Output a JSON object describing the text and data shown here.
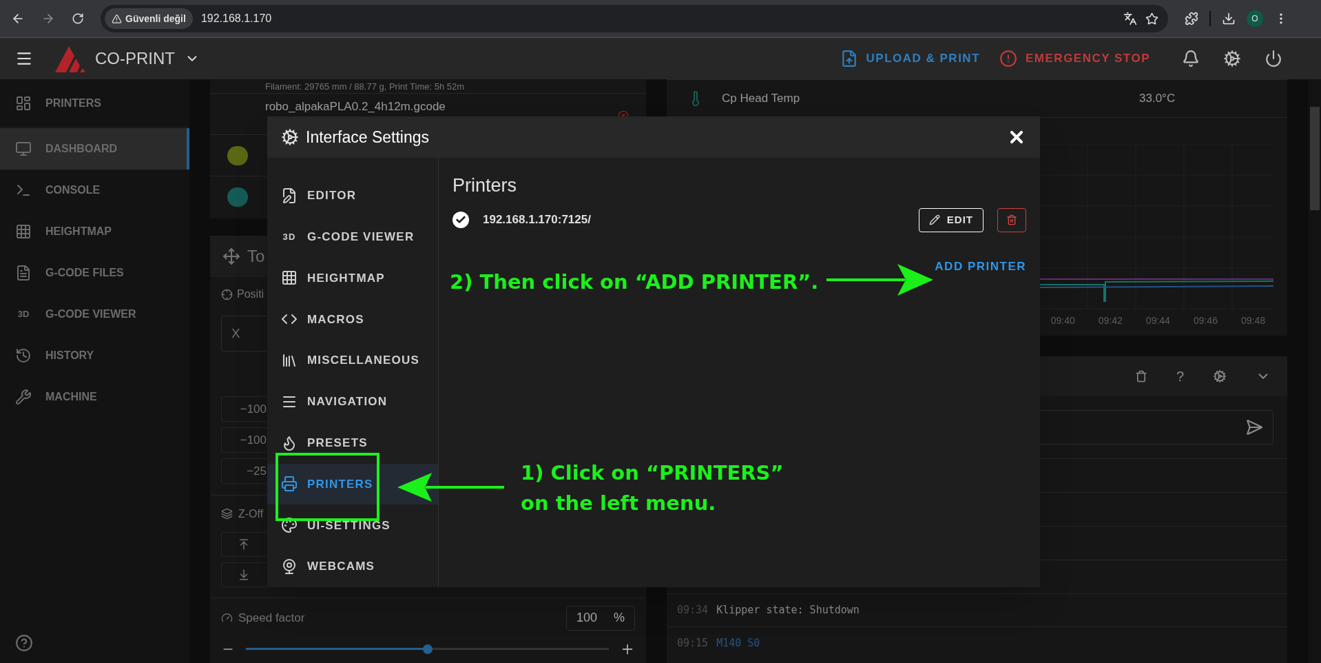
{
  "browser": {
    "security_label": "Güvenli değil",
    "url": "192.168.1.170",
    "profile_initial": "O"
  },
  "app_bar": {
    "brand": "CO-PRINT",
    "actions": [
      {
        "kind": "upload",
        "label": "UPLOAD & PRINT"
      },
      {
        "kind": "stop",
        "label": "EMERGENCY STOP"
      }
    ]
  },
  "sidebar": {
    "items": [
      {
        "kind": "printers",
        "label": "PRINTERS",
        "selected": false
      },
      {
        "kind": "dashboard",
        "label": "DASHBOARD",
        "selected": true
      },
      {
        "kind": "console",
        "label": "CONSOLE",
        "selected": false
      },
      {
        "kind": "heightmap",
        "label": "HEIGHTMAP",
        "selected": false
      },
      {
        "kind": "files",
        "label": "G-CODE FILES",
        "selected": false
      },
      {
        "kind": "viewer",
        "icon_text": "3D",
        "label": "G-CODE VIEWER",
        "selected": false
      },
      {
        "kind": "history",
        "label": "HISTORY",
        "selected": false
      },
      {
        "kind": "machine",
        "label": "MACHINE",
        "selected": false
      }
    ]
  },
  "files": {
    "details": "Filament: 29765 mm / 88.77 g, Print Time: 5h 52m",
    "name": "robo_alpakaPLA0.2_4h12m.gcode"
  },
  "toolhead": {
    "title": "To",
    "position_label": "Positi",
    "axis": "X",
    "moves": [
      "−100",
      "−100",
      "−25"
    ],
    "zoffset_label": "Z-Off",
    "speed": {
      "label": "Speed factor",
      "value": "100",
      "unit": "%",
      "level": 0.5
    }
  },
  "sensors": [
    {
      "name": "Cp Head Temp",
      "value": "33.0°C"
    }
  ],
  "temp_chart": {
    "time_labels": [
      "09:40",
      "09:42",
      "09:44",
      "09:46",
      "09:48"
    ]
  },
  "console": {
    "help_glyph": "?",
    "entries": [
      {
        "kind": "message",
        "time": "09:34",
        "text": "Klipper state: Shutdown"
      },
      {
        "kind": "command",
        "time": "09:15",
        "text": "M140 S0"
      }
    ]
  },
  "dialog": {
    "title": "Interface Settings",
    "nav": [
      {
        "kind": "editor",
        "label": "EDITOR",
        "selected": false
      },
      {
        "kind": "viewer",
        "icon_text": "3D",
        "label": "G-CODE VIEWER",
        "selected": false
      },
      {
        "kind": "heightmap",
        "label": "HEIGHTMAP",
        "selected": false
      },
      {
        "kind": "macros",
        "label": "MACROS",
        "selected": false
      },
      {
        "kind": "misc",
        "label": "MISCELLANEOUS",
        "selected": false
      },
      {
        "kind": "navigation",
        "label": "NAVIGATION",
        "selected": false
      },
      {
        "kind": "presets",
        "label": "PRESETS",
        "selected": false
      },
      {
        "kind": "printers",
        "label": "PRINTERS",
        "selected": true
      },
      {
        "kind": "ui",
        "label": "UI-SETTINGS",
        "selected": false
      },
      {
        "kind": "webcams",
        "label": "WEBCAMS",
        "selected": false
      }
    ],
    "section_title": "Printers",
    "printers": [
      {
        "address": "192.168.1.170:7125/",
        "connected": true
      }
    ],
    "edit_label": "EDIT",
    "add_label": "ADD PRINTER"
  },
  "annotations": [
    {
      "lines": [
        "2) Then click on “ADD PRINTER”."
      ]
    },
    {
      "lines": [
        "1) Click on “PRINTERS”",
        "on the left menu."
      ]
    }
  ]
}
